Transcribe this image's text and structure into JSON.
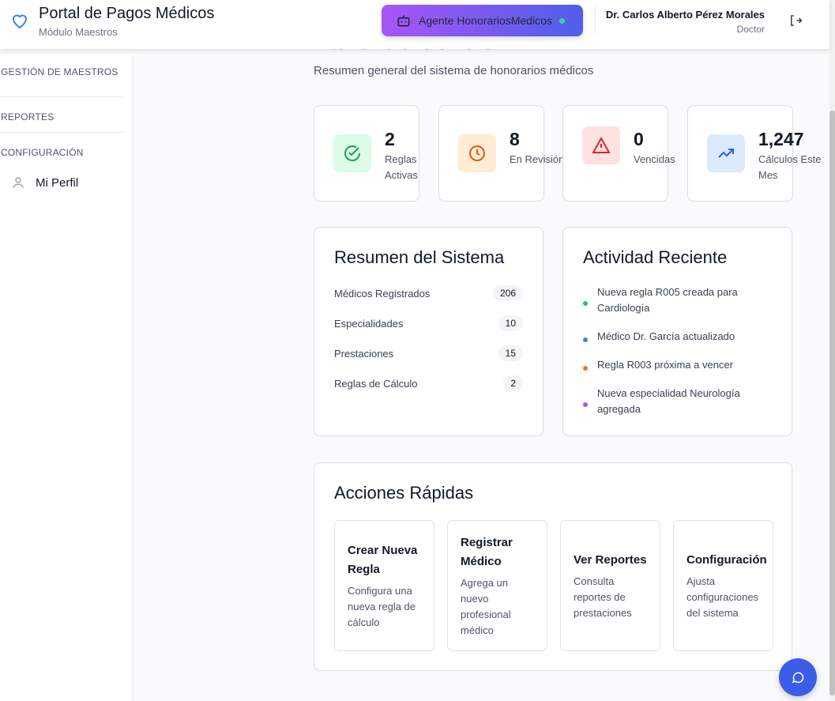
{
  "header": {
    "title": "Portal de Pagos Médicos",
    "subtitle": "Módulo Maestros",
    "agent_label": "Agente HonorariosMedicos",
    "user_name": "Dr. Carlos Alberto Pérez Morales",
    "user_role": "Doctor"
  },
  "sidebar": {
    "sections": [
      "GESTIÓN DE MAESTROS",
      "REPORTES",
      "CONFIGURACIÓN"
    ],
    "items": [
      {
        "label": "Mi Perfil",
        "icon": "user-icon"
      }
    ]
  },
  "page": {
    "title": "Panel de Control",
    "subtitle": "Resumen general del sistema de honorarios médicos"
  },
  "stats": [
    {
      "value": "2",
      "label": "Reglas Activas",
      "icon": "check-circle-icon",
      "color": "#16a34a"
    },
    {
      "value": "8",
      "label": "En Revisión",
      "icon": "clock-icon",
      "color": "#ea580c"
    },
    {
      "value": "0",
      "label": "Vencidas",
      "icon": "alert-triangle-icon",
      "color": "#dc2626"
    },
    {
      "value": "1,247",
      "label": "Cálculos Este Mes",
      "icon": "trending-up-icon",
      "color": "#2563eb"
    }
  ],
  "summary": {
    "title": "Resumen del Sistema",
    "rows": [
      {
        "label": "Médicos Registrados",
        "value": "206"
      },
      {
        "label": "Especialidades",
        "value": "10"
      },
      {
        "label": "Prestaciones",
        "value": "15"
      },
      {
        "label": "Reglas de Cálculo",
        "value": "2"
      }
    ]
  },
  "activity": {
    "title": "Actividad Reciente",
    "items": [
      {
        "text": "Nueva regla R005 creada para Cardiología",
        "color": "#22c55e"
      },
      {
        "text": "Médico Dr. García actualizado",
        "color": "#3b82f6"
      },
      {
        "text": "Regla R003 próxima a vencer",
        "color": "#f97316"
      },
      {
        "text": "Nueva especialidad Neurología agregada",
        "color": "#a855f7"
      }
    ]
  },
  "quick": {
    "title": "Acciones Rápidas",
    "items": [
      {
        "title": "Crear Nueva Regla",
        "desc": "Configura una nueva regla de cálculo"
      },
      {
        "title": "Registrar Médico",
        "desc": "Agrega un nuevo profesional médico"
      },
      {
        "title": "Ver Reportes",
        "desc": "Consulta reportes de prestaciones"
      },
      {
        "title": "Configuración",
        "desc": "Ajusta configuraciones del sistema"
      }
    ]
  }
}
